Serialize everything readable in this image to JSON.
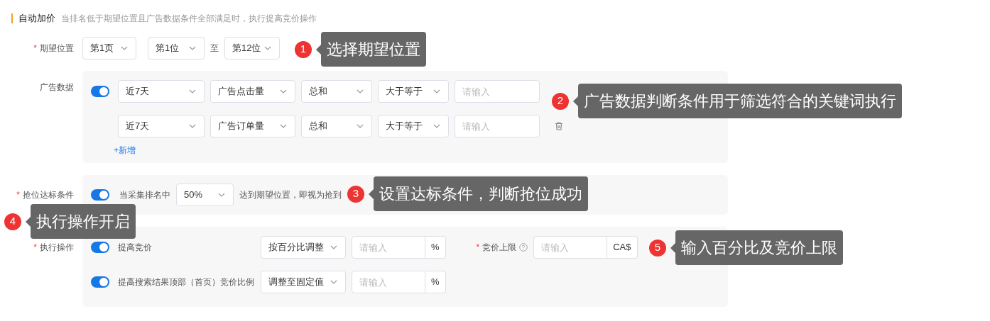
{
  "header": {
    "title": "自动加价",
    "subtitle": "当排名低于期望位置且广告数据条件全部满足时，执行提高竞价操作"
  },
  "expected_position": {
    "label": "期望位置",
    "required_mark": "*",
    "selects": [
      "第1页",
      "第1位",
      "第12位"
    ],
    "separator": "至"
  },
  "ad_data": {
    "label": "广告数据",
    "enabled": true,
    "rows": [
      {
        "selects": [
          "近7天",
          "广告点击量",
          "总和",
          "大于等于"
        ],
        "placeholder": "请输入",
        "deletable": false
      },
      {
        "selects": [
          "近7天",
          "广告订单量",
          "总和",
          "大于等于"
        ],
        "placeholder": "请输入",
        "deletable": true
      }
    ],
    "add_label": "+新增"
  },
  "grab_condition": {
    "label": "抢位达标条件",
    "required_mark": "*",
    "enabled": true,
    "text_before": "当采集排名中",
    "select": "50%",
    "text_after": "达到期望位置，即视为抢到"
  },
  "execute": {
    "label": "执行操作",
    "required_mark": "*",
    "actions": [
      {
        "enabled": true,
        "label": "提高竞价",
        "select": "按百分比调整",
        "placeholder": "请输入",
        "unit": "%"
      },
      {
        "enabled": true,
        "label": "提高搜索结果顶部（首页）竞价比例",
        "select": "调整至固定值",
        "placeholder": "请输入",
        "unit": "%"
      }
    ],
    "bid_limit": {
      "label": "竞价上限",
      "required_mark": "*",
      "placeholder": "请输入",
      "unit": "CA$"
    }
  },
  "callouts": [
    {
      "number": "1",
      "text": "选择期望位置"
    },
    {
      "number": "2",
      "text": "广告数据判断条件用于筛选符合的关键词执行"
    },
    {
      "number": "3",
      "text": "设置达标条件，判断抢位成功"
    },
    {
      "number": "4",
      "text": "执行操作开启"
    },
    {
      "number": "5",
      "text": "输入百分比及竞价上限"
    }
  ]
}
